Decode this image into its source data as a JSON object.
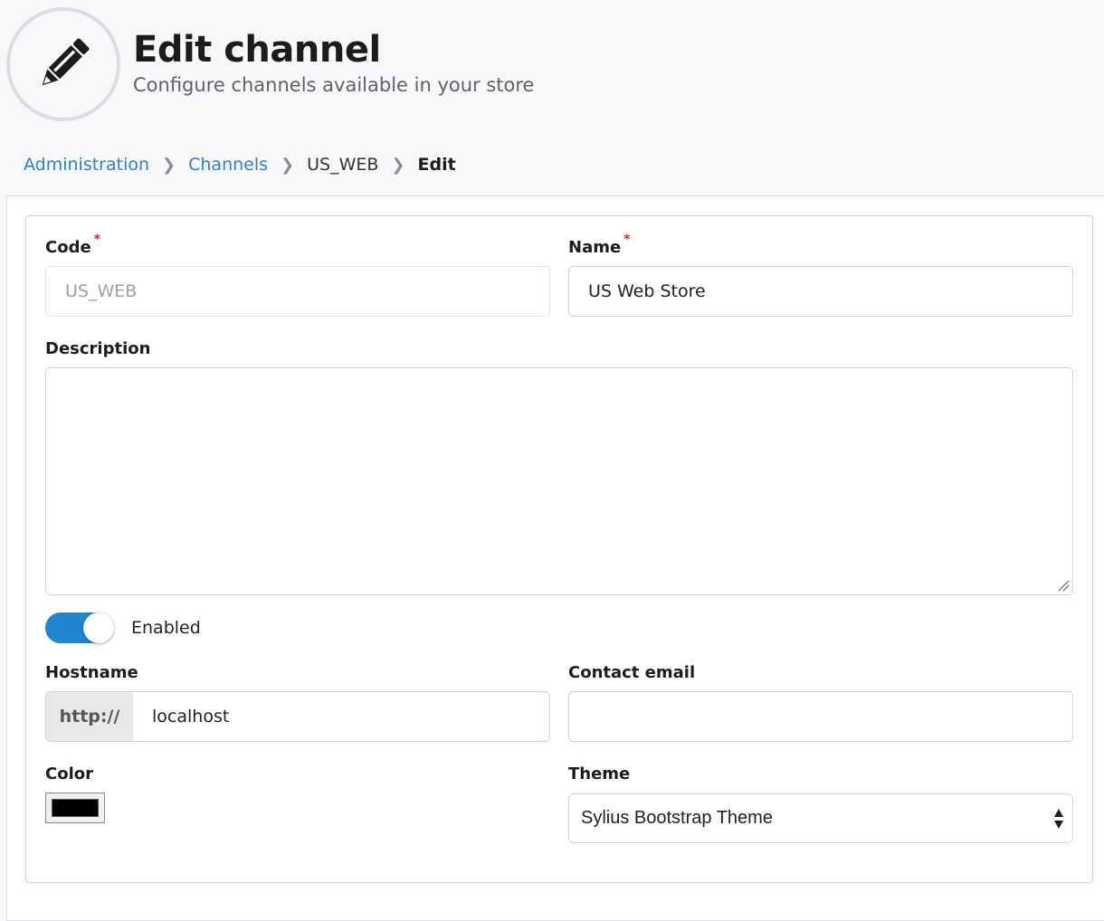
{
  "header": {
    "icon": "pencil-icon",
    "title": "Edit channel",
    "subtitle": "Configure channels available in your store"
  },
  "breadcrumb": {
    "items": [
      "Administration",
      "Channels",
      "US_WEB",
      "Edit"
    ]
  },
  "form": {
    "code": {
      "label": "Code",
      "required_mark": "*",
      "value": "US_WEB",
      "disabled": true
    },
    "name": {
      "label": "Name",
      "required_mark": "*",
      "value": "US Web Store"
    },
    "description": {
      "label": "Description",
      "value": ""
    },
    "enabled": {
      "label": "Enabled",
      "on": true
    },
    "hostname": {
      "label": "Hostname",
      "prefix": "http://",
      "value": "localhost"
    },
    "contact_email": {
      "label": "Contact email",
      "value": ""
    },
    "color": {
      "label": "Color",
      "value": "#000000"
    },
    "theme": {
      "label": "Theme",
      "selected": "Sylius Bootstrap Theme"
    }
  },
  "colors": {
    "accent": "#2185d0",
    "link": "#2f80c9",
    "required": "#db2828"
  }
}
